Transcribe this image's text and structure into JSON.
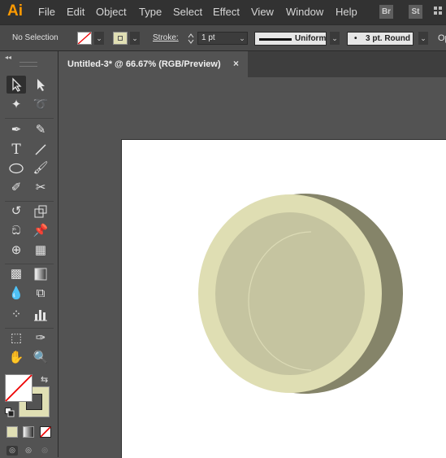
{
  "app": {
    "logo": "Ai"
  },
  "menu": [
    "File",
    "Edit",
    "Object",
    "Type",
    "Select",
    "Effect",
    "View",
    "Window",
    "Help"
  ],
  "bridge_buttons": [
    "Br",
    "St"
  ],
  "control_bar": {
    "selection": "No Selection",
    "stroke_label": "Stroke:",
    "stroke_weight": "1 pt",
    "profile": "Uniform",
    "brush": "3 pt. Round",
    "opacity_label": "Op"
  },
  "document": {
    "tab_title": "Untitled-3* @ 66.67% (RGB/Preview)",
    "close_glyph": "×"
  },
  "colors": {
    "fill": "#e0dfb4",
    "coin_face": "#dfdeb3",
    "coin_inner": "#c5c4a0",
    "coin_edge": "#858469",
    "accent_logo": "#ff9a00"
  },
  "toolbox": {
    "collapse_glyph": "◂◂",
    "swap_glyph": "⇆"
  }
}
